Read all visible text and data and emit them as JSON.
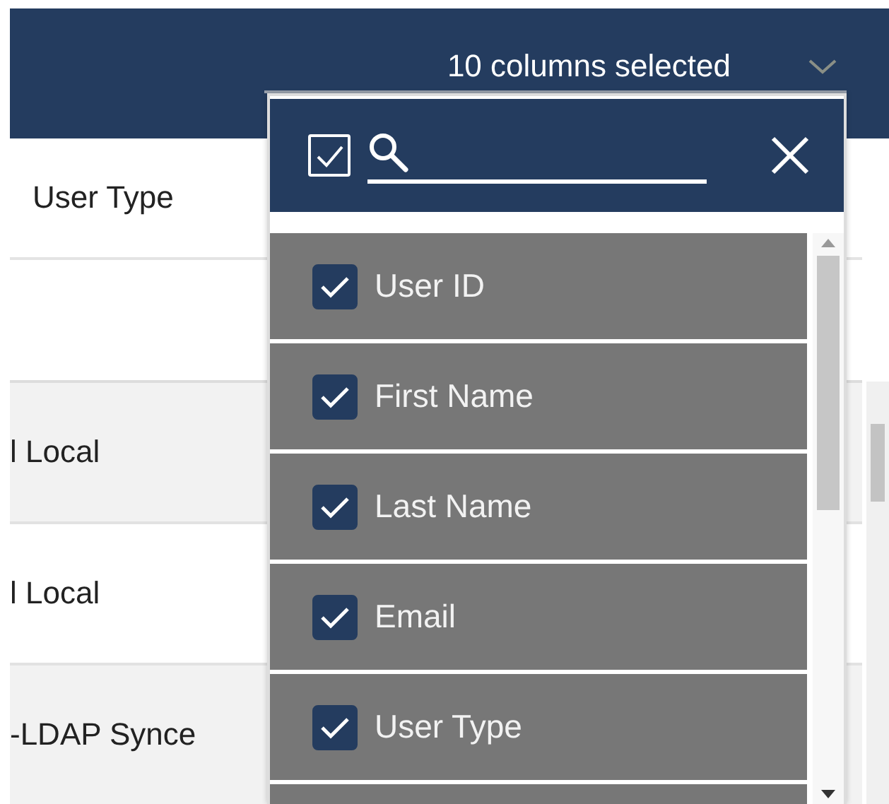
{
  "column_select": {
    "summary": "10 columns selected",
    "expanded": true
  },
  "column_panel": {
    "select_all": {
      "checked": true
    },
    "items": [
      {
        "label": "User ID",
        "checked": true
      },
      {
        "label": "First Name",
        "checked": true
      },
      {
        "label": "Last Name",
        "checked": true
      },
      {
        "label": "Email",
        "checked": true
      },
      {
        "label": "User Type",
        "checked": true
      }
    ]
  },
  "table": {
    "columns": [
      "User Type"
    ],
    "rows": [
      {
        "cells": [
          "l Local"
        ]
      },
      {
        "cells": [
          "l Local"
        ]
      },
      {
        "cells": [
          "-LDAP Synce"
        ]
      }
    ]
  }
}
